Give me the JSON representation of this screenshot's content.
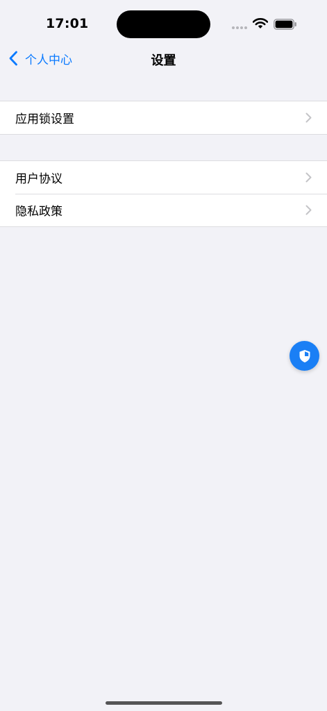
{
  "status_bar": {
    "time": "17:01",
    "icons": [
      "signal-icon",
      "wifi-icon",
      "battery-icon"
    ]
  },
  "nav": {
    "back_label": "个人中心",
    "title": "设置"
  },
  "groups": [
    {
      "items": [
        {
          "label": "应用锁设置"
        }
      ]
    },
    {
      "items": [
        {
          "label": "用户协议"
        },
        {
          "label": "隐私政策"
        }
      ]
    }
  ],
  "fab": {
    "icon": "shield-icon"
  },
  "colors": {
    "accent": "#0a7aff",
    "background": "#f2f2f7",
    "fab": "#1a7ff5"
  }
}
